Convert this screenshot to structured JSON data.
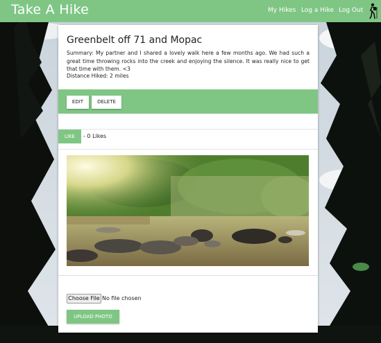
{
  "navbar": {
    "brand": "Take A Hike",
    "links": [
      {
        "label": "My Hikes"
      },
      {
        "label": "Log a Hike"
      },
      {
        "label": "Log Out"
      }
    ],
    "icon": "hiker-icon",
    "color": "#7fc685"
  },
  "hike": {
    "title": "Greenbelt off 71 and Mopac",
    "summary": "Summary: My partner and I shared a lovely walk here a few months ago. We had such a great time throwing rocks into the creek and enjoying the silence. It was really nice to get that time with them. <3",
    "distance": "Distance Hiked: 2 miles"
  },
  "actions": {
    "edit_label": "EDIT",
    "delete_label": "DELETE"
  },
  "likes": {
    "button_label": "LIKE",
    "count_text": "- 0 Likes"
  },
  "upload": {
    "choose_label": "Choose File",
    "status": "No file chosen",
    "upload_label": "UPLOAD PHOTO"
  }
}
